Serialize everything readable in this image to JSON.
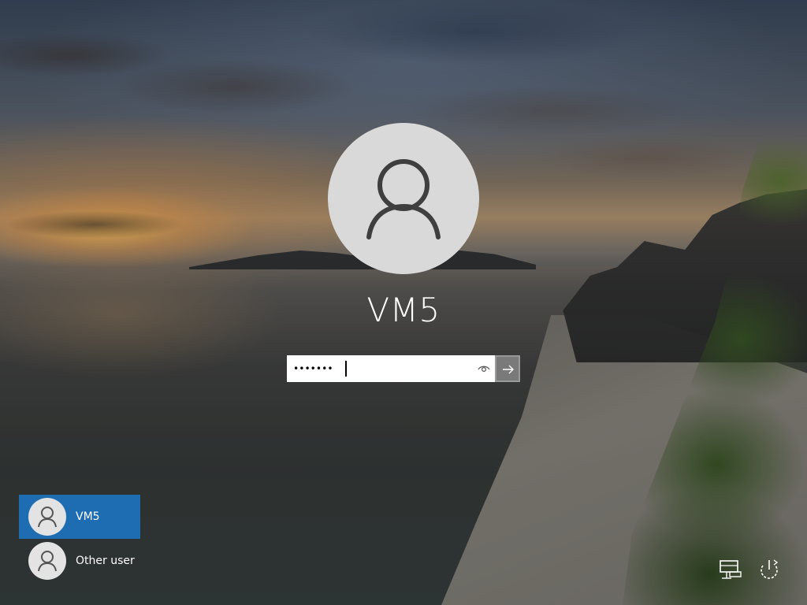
{
  "login": {
    "username": "VM5",
    "password_mask": "•••••••",
    "submit_icon": "arrow-right-icon",
    "reveal_icon": "eye-icon"
  },
  "user_list": [
    {
      "name": "VM5",
      "selected": true,
      "icon": "user-icon"
    },
    {
      "name": "Other user",
      "selected": false,
      "icon": "user-icon"
    }
  ],
  "system_tray": {
    "network_icon": "network-icon",
    "power_icon": "power-icon"
  },
  "colors": {
    "selected_user_bg": "#1e6db2",
    "avatar_bg": "#d9d9d9",
    "submit_bg": "#7a7a7a",
    "text": "#ffffff"
  }
}
